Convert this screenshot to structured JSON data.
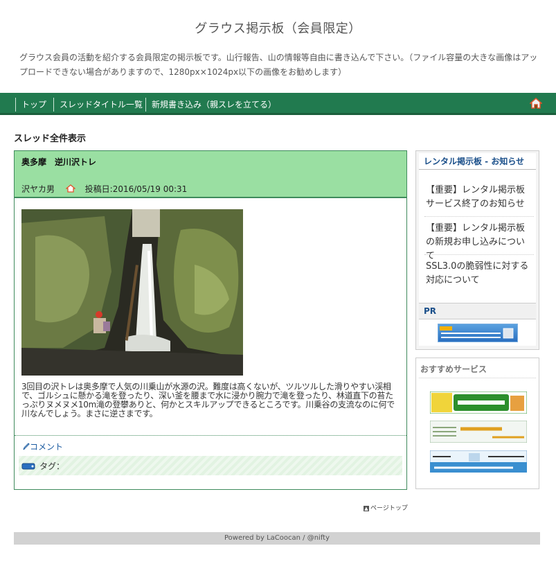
{
  "header": {
    "title": "グラウス掲示板（会員限定）",
    "description": "グラウス会員の活動を紹介する会員限定の掲示板です。山行報告、山の情報等自由に書き込んで下さい。（ファイル容量の大きな画像はアップロードできない場合がありますので、1280px×1024px以下の画像をお勧めします）"
  },
  "nav": {
    "items": [
      "トップ",
      "スレッドタイトル一覧",
      "新規書き込み（親スレを立てる）"
    ],
    "home_icon": "home-icon"
  },
  "main": {
    "section_title": "スレッド全件表示",
    "thread": {
      "subject": "奥多摩　逆川沢トレ",
      "author": "沢ヤカ男",
      "posted": "投稿日:2016/05/19 00:31",
      "body": "3回目の沢トレは奥多摩で人気の川乗山が水源の沢。難度は高くないが、ツルツルした滑りやすい渓相で、ゴルシュに懸かる滝を登ったり、深い釜を腰まで水に浸かり腕力で滝を登ったり、林道直下の苔たっぷりヌメヌメ10m滝の登攀ありと、何かとスキルアップできるところです。川乗谷の支流なのに何で川なんでしょう。まさに逆さまです。",
      "comment_label": "コメント",
      "tag_label": "タグ："
    },
    "pagetop": "ページトップ"
  },
  "sidebar": {
    "notice_title": "レンタル掲示板 - お知らせ",
    "notices": [
      "【重要】レンタル掲示板サービス終了のお知らせ",
      "【重要】レンタル掲示板の新規お申し込みについて",
      "SSL3.0の脆弱性に対する対応について"
    ],
    "pr_title": "PR",
    "pr_banner": "ニフティクラウド ベーシックホスティング",
    "recommend_title": "おすすめサービス",
    "recommend_banners": [
      "InterPot",
      "ドメイン @nifty",
      "@nifty レンタルサーバー ホームページサービス"
    ]
  },
  "footer": {
    "text": "Powered by LaCoocan / @nifty"
  },
  "colors": {
    "nav_bg": "#217a4f",
    "thread_head_bg": "#9adfa2",
    "link": "#1a5aa0"
  }
}
